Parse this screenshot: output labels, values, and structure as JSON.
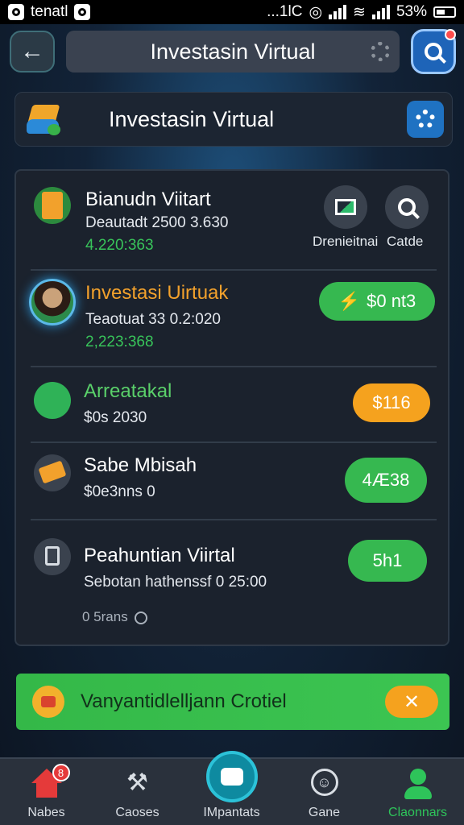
{
  "status_bar": {
    "carrier": "tenatl",
    "dots": "...1lC",
    "battery": "53%"
  },
  "top_bar": {
    "back_icon": "arrow-left-icon",
    "title": "Investasin Virtual",
    "search_icon": "search-icon"
  },
  "header": {
    "title": "Investasin Virtual",
    "logo_icon": "investment-logo-icon",
    "settings_icon": "gear-icon"
  },
  "items": [
    {
      "name": "Bianudn Viitart",
      "sub": "Deautadt 2500 3.630",
      "value": "4.220:363",
      "actions": [
        {
          "label": "Drenieitnai",
          "icon": "chart-screen-icon"
        },
        {
          "label": "Catde",
          "icon": "zoom-icon"
        }
      ]
    },
    {
      "name": "Investasi Uirtuak",
      "sub": "Teaotuat 33 0.2:020",
      "value": "2,223:368",
      "button": "$0 nt3"
    },
    {
      "name": "Arreatakal",
      "sub": "$0s 2030",
      "button": "$116"
    },
    {
      "name": "Sabe Mbisah",
      "sub": "$0e3nns 0",
      "button": "4Æ38"
    },
    {
      "name": "Peahuntian Viirtal",
      "sub": "Sebotan hathenssf 0 25:00",
      "button": "5h1",
      "extra": "0 5rans"
    }
  ],
  "promo": {
    "label": "Vanyantidlelljann Crotiel",
    "button_icon": "close-x-icon"
  },
  "nav": [
    {
      "label": "Nabes",
      "icon": "home-icon",
      "badge": "8"
    },
    {
      "label": "Caoses",
      "icon": "tools-icon"
    },
    {
      "label": "IMpantats",
      "icon": "chat-icon"
    },
    {
      "label": "Gane",
      "icon": "smiley-icon"
    },
    {
      "label": "Claonnars",
      "icon": "person-icon"
    }
  ],
  "colors": {
    "accent_green": "#38c45a",
    "accent_orange": "#f5a21e",
    "accent_blue": "#1f72c2",
    "panel_bg": "#1b222d"
  }
}
